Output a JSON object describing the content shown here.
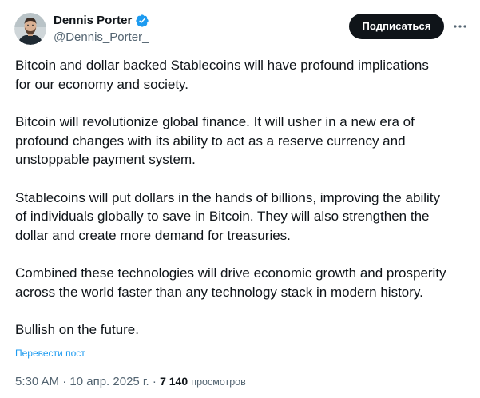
{
  "author": {
    "display_name": "Dennis Porter",
    "handle": "@Dennis_Porter_",
    "verified": true
  },
  "actions": {
    "subscribe_label": "Подписаться",
    "more_icon": "more-horizontal-icon"
  },
  "tweet": {
    "paragraphs": [
      "Bitcoin and dollar backed Stablecoins will have profound implications\nfor our economy and society.",
      "Bitcoin will revolutionize global finance. It will usher in a new era of\nprofound changes with its ability to act as a reserve currency and\nunstoppable payment system.",
      "Stablecoins will put dollars in the hands of billions, improving the ability\nof individuals globally to save in Bitcoin. They will also strengthen the\ndollar and create more demand for treasuries.",
      "Combined these technologies will drive economic growth and prosperity\nacross the world faster than any technology stack in modern history.",
      "Bullish on the future."
    ],
    "translate_label": "Перевести пост",
    "time": "5:30 AM",
    "separator": "·",
    "date": "10 апр. 2025 г.",
    "views_count": "7 140",
    "views_label": "просмотров"
  },
  "colors": {
    "text_primary": "#0f1419",
    "text_secondary": "#536471",
    "link": "#1d9bf0",
    "verified": "#1d9bf0",
    "button_bg": "#0f1419"
  }
}
